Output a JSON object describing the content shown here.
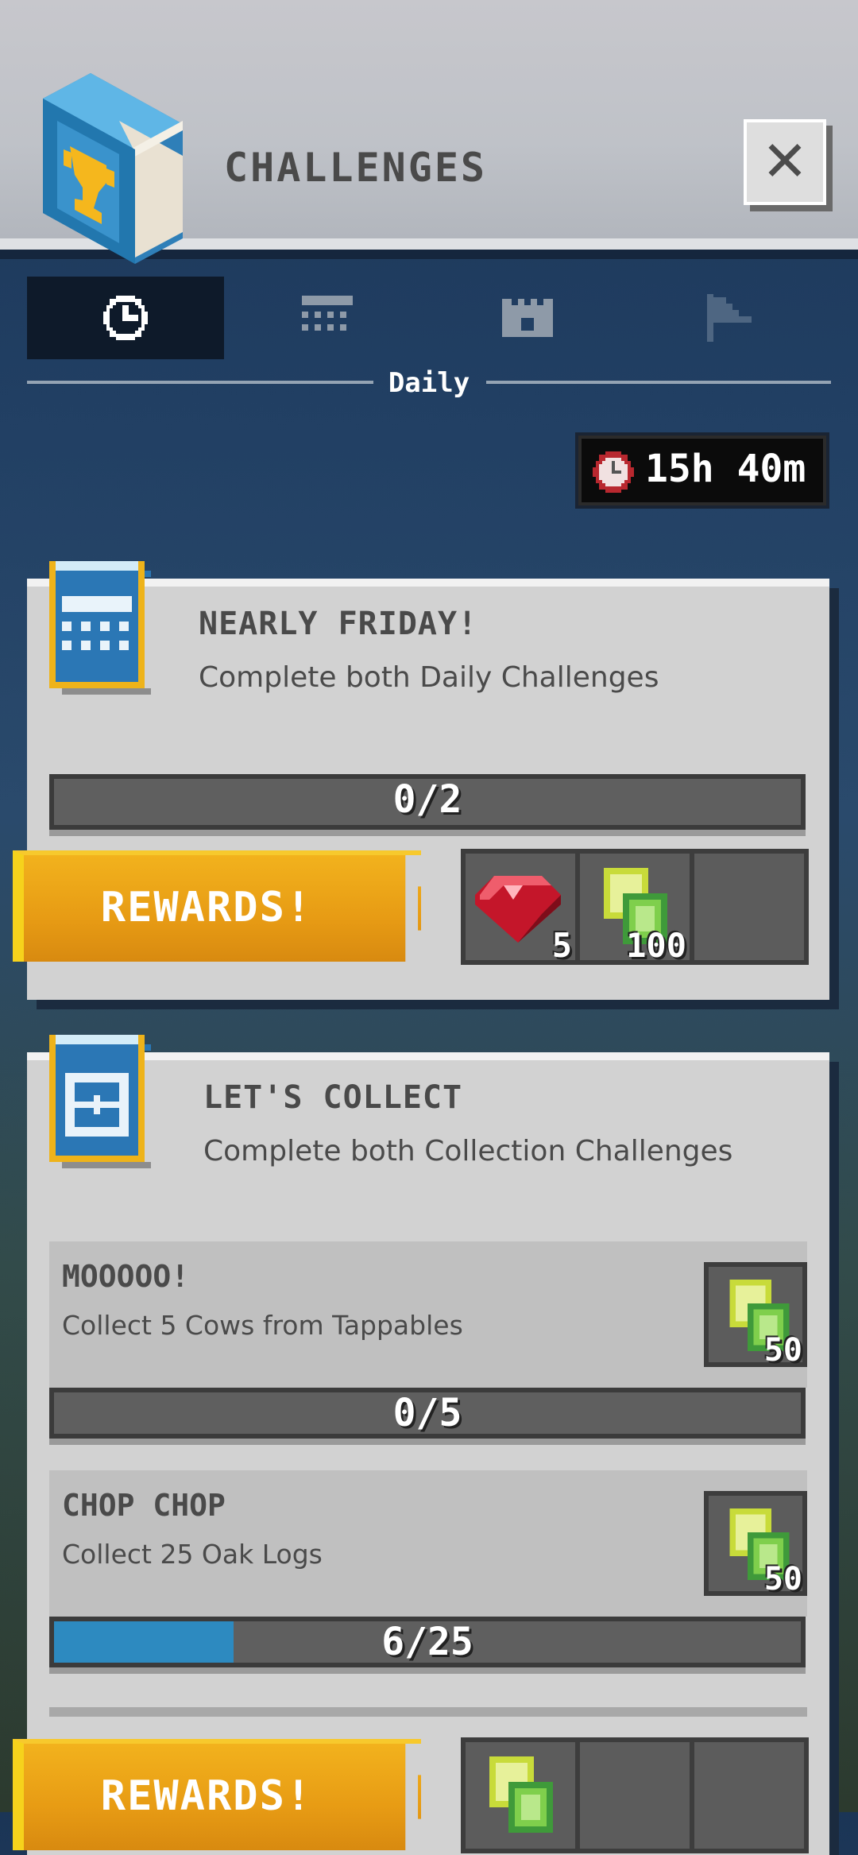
{
  "header": {
    "title": "CHALLENGES",
    "close_label": "✕"
  },
  "tabs": [
    {
      "icon": "clock-icon",
      "active": true
    },
    {
      "icon": "calendar-icon",
      "active": false
    },
    {
      "icon": "castle-icon",
      "active": false
    },
    {
      "icon": "flag-icon",
      "active": false
    }
  ],
  "tab_label": "Daily",
  "timer": {
    "text": "15h 40m",
    "icon": "clock-icon"
  },
  "cards": [
    {
      "title": "NEARLY FRIDAY!",
      "description": "Complete both Daily Challenges",
      "progress": {
        "current": 0,
        "total": 2,
        "label": "0/2"
      },
      "rewards_label": "REWARDS!",
      "rewards": [
        {
          "icon": "ruby-icon",
          "qty": "5"
        },
        {
          "icon": "rubies-currency-icon",
          "qty": "100"
        },
        {
          "icon": "empty-slot",
          "qty": ""
        }
      ]
    },
    {
      "title": "LET'S COLLECT",
      "description": "Complete both Collection Challenges",
      "subchallenges": [
        {
          "title": "MOOOOO!",
          "description": "Collect 5 Cows from Tappables",
          "reward_qty": "50",
          "progress": {
            "current": 0,
            "total": 5,
            "label": "0/5"
          }
        },
        {
          "title": "CHOP CHOP",
          "description": "Collect 25 Oak Logs",
          "reward_qty": "50",
          "progress": {
            "current": 6,
            "total": 25,
            "label": "6/25"
          }
        }
      ],
      "rewards_label": "REWARDS!"
    }
  ],
  "colors": {
    "accent_blue": "#2d8ac0",
    "reward_orange": "#e79b14",
    "ruby": "#c4162a",
    "xp_green": "#a8d12a"
  }
}
